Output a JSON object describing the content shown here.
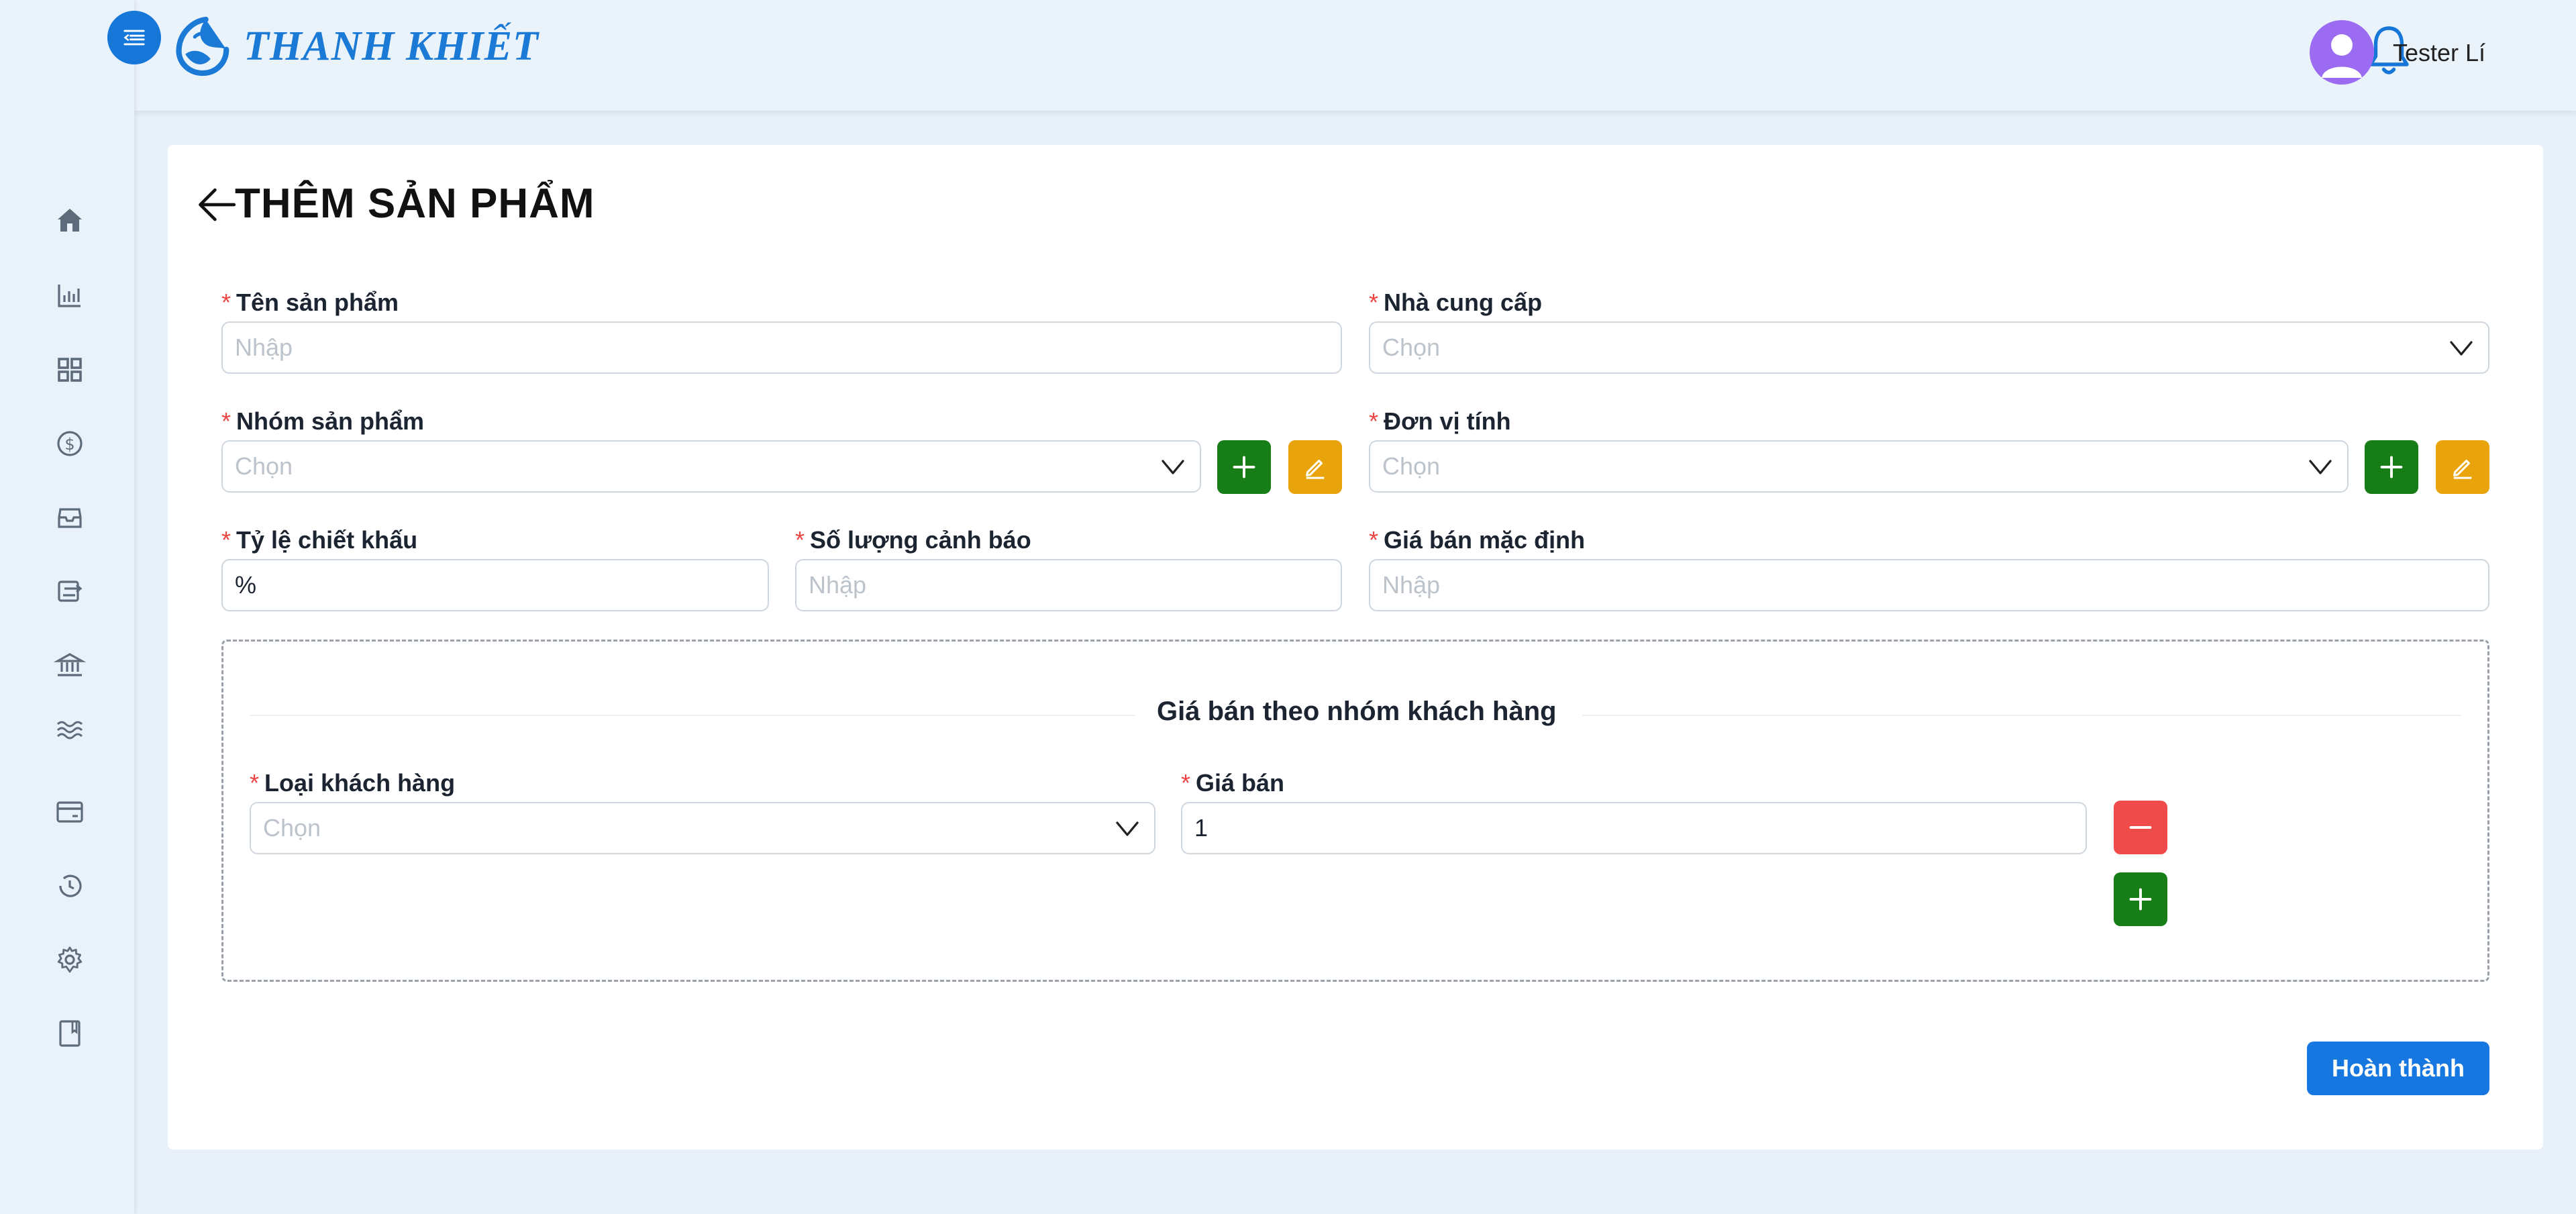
{
  "app": {
    "brand": "THANH KHIẾT"
  },
  "header": {
    "user_name": "Tester Lí"
  },
  "sidebar": {
    "items": [
      {
        "icon": "home-icon"
      },
      {
        "icon": "bar-chart-icon"
      },
      {
        "icon": "grid-icon"
      },
      {
        "icon": "dollar-icon"
      },
      {
        "icon": "inbox-icon"
      },
      {
        "icon": "transfer-icon"
      },
      {
        "icon": "bank-icon"
      },
      {
        "icon": "waves-icon"
      },
      {
        "icon": "card-icon"
      },
      {
        "icon": "history-icon"
      },
      {
        "icon": "settings-icon"
      },
      {
        "icon": "book-icon"
      }
    ]
  },
  "page": {
    "title": "THÊM SẢN PHẨM"
  },
  "form": {
    "required_mark": "*",
    "product_name": {
      "label": "Tên sản phẩm",
      "placeholder": "Nhập"
    },
    "supplier": {
      "label": "Nhà cung cấp",
      "placeholder": "Chọn"
    },
    "product_group": {
      "label": "Nhóm sản phẩm",
      "placeholder": "Chọn"
    },
    "unit": {
      "label": "Đơn vị tính",
      "placeholder": "Chọn"
    },
    "discount_rate": {
      "label": "Tỷ lệ chiết khấu",
      "value": "%"
    },
    "warning_qty": {
      "label": "Số lượng cảnh báo",
      "placeholder": "Nhập"
    },
    "default_price": {
      "label": "Giá bán mặc định",
      "placeholder": "Nhập"
    },
    "group_pricing": {
      "title": "Giá bán theo nhóm khách hàng",
      "customer_type": {
        "label": "Loại khách hàng",
        "placeholder": "Chọn"
      },
      "price": {
        "label": "Giá bán",
        "value": "1"
      }
    },
    "submit_label": "Hoàn thành"
  },
  "colors": {
    "primary": "#1677e0",
    "success": "#177d16",
    "warning": "#eaa40b",
    "danger": "#f04b4b",
    "required": "#ef4444"
  }
}
